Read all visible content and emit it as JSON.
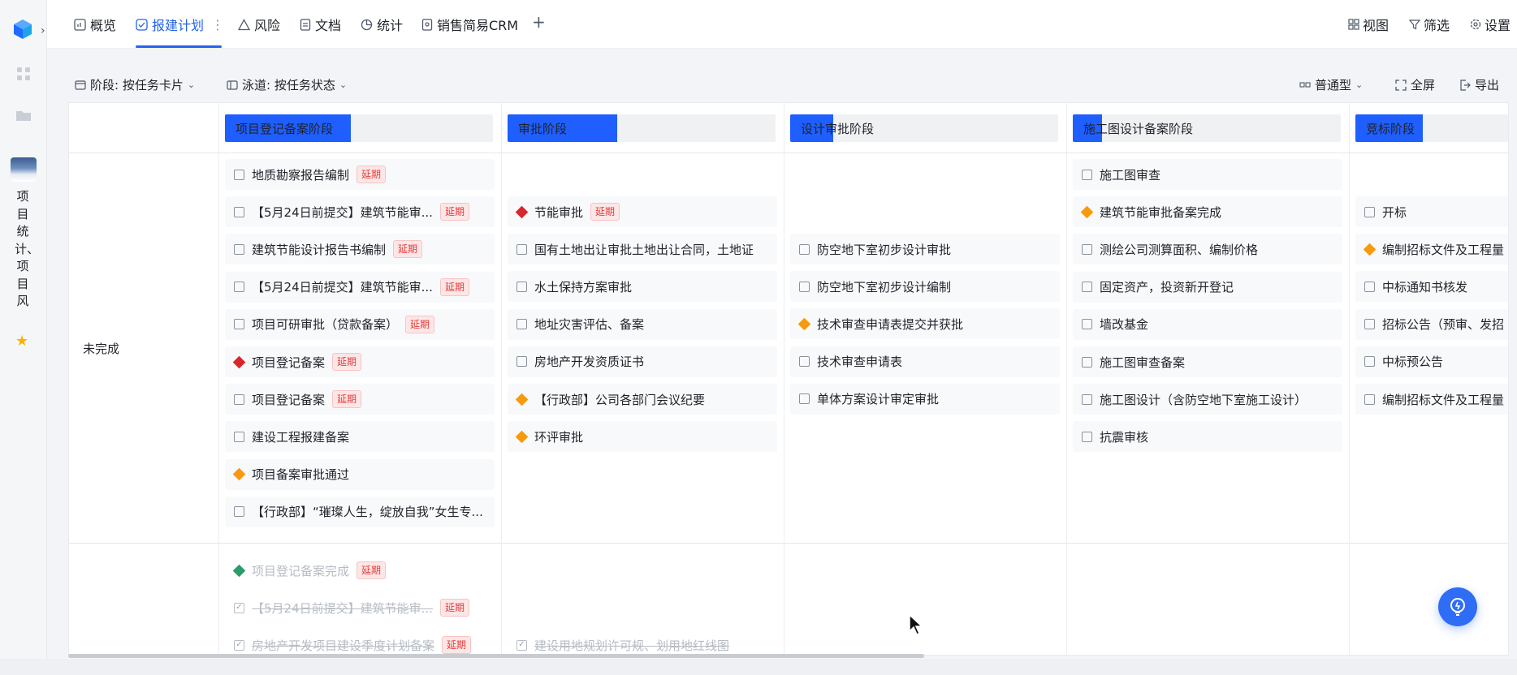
{
  "rail": {
    "logo_icon": "cube-logo-icon",
    "expand_icon": "chevron-right-icon",
    "apps_icon": "apps-grid-icon",
    "folder_icon": "folder-icon",
    "project_name": "项目统计、项目风",
    "favorite_icon": "star-icon"
  },
  "tabs": [
    {
      "label": "概览",
      "icon": "overview-icon"
    },
    {
      "label": "报建计划",
      "icon": "check-circle-icon",
      "active": true
    },
    {
      "label": "风险",
      "icon": "warning-icon"
    },
    {
      "label": "文档",
      "icon": "document-icon"
    },
    {
      "label": "统计",
      "icon": "chart-icon"
    },
    {
      "label": "销售简易CRM",
      "icon": "crm-icon"
    }
  ],
  "more_icon": "vertical-dots-icon",
  "add_tab_icon": "plus-icon",
  "top_actions": {
    "view": "视图",
    "filter": "筛选",
    "settings": "设置"
  },
  "toolbar": {
    "stage": "阶段: 按任务卡片",
    "lane": "泳道: 按任务状态",
    "card_type": "普通型",
    "fullscreen": "全屏",
    "export": "导出"
  },
  "colors": {
    "accent": "#1f5eff",
    "red": "#d8262b",
    "orange": "#f79a0d",
    "green": "#2e9b6b"
  },
  "stages": [
    {
      "title": "项目登记备案阶段",
      "progress": 0.47
    },
    {
      "title": "审批阶段",
      "progress": 0.41
    },
    {
      "title": "设计审批阶段",
      "progress": 0.16
    },
    {
      "title": "施工图设计备案阶段",
      "progress": 0.11
    },
    {
      "title": "竞标阶段",
      "progress": 0.25
    }
  ],
  "lanes": {
    "incomplete": "未完成"
  },
  "delay_label": "延期",
  "columns": [
    {
      "incomplete": [
        {
          "text": "地质勘察报告编制",
          "marker": "checkbox",
          "delay": true
        },
        {
          "text": "【5月24日前提交】建筑节能审...",
          "marker": "checkbox",
          "delay": true
        },
        {
          "text": "建筑节能设计报告书编制",
          "marker": "checkbox",
          "delay": true
        },
        {
          "text": "【5月24日前提交】建筑节能审...",
          "marker": "checkbox",
          "delay": true
        },
        {
          "text": "项目可研审批（贷款备案）",
          "marker": "checkbox",
          "delay": true
        },
        {
          "text": "项目登记备案",
          "marker": "red",
          "delay": true
        },
        {
          "text": "项目登记备案",
          "marker": "checkbox",
          "delay": true
        },
        {
          "text": "建设工程报建备案",
          "marker": "checkbox",
          "delay": false
        },
        {
          "text": "项目备案审批通过",
          "marker": "orange",
          "delay": false
        },
        {
          "text": "【行政部】“璀璨人生，绽放自我”女生专...",
          "marker": "checkbox",
          "delay": false
        }
      ],
      "complete": [
        {
          "text": "项目登记备案完成",
          "marker": "green",
          "delay": true
        },
        {
          "text": "【5月24日前提交】建筑节能审...",
          "marker": "checked",
          "delay": true
        },
        {
          "text": "房地产开发项目建设季度计划备案",
          "marker": "checked",
          "delay": true
        }
      ]
    },
    {
      "incomplete": [
        {
          "text": "节能审批",
          "marker": "red",
          "delay": true
        },
        {
          "text": "国有土地出让审批土地出让合同，土地证",
          "marker": "checkbox",
          "delay": false
        },
        {
          "text": "水土保持方案审批",
          "marker": "checkbox",
          "delay": false
        },
        {
          "text": "地址灾害评估、备案",
          "marker": "checkbox",
          "delay": false
        },
        {
          "text": "房地产开发资质证书",
          "marker": "checkbox",
          "delay": false
        },
        {
          "text": "【行政部】公司各部门会议纪要",
          "marker": "orange",
          "delay": false
        },
        {
          "text": "环评审批",
          "marker": "orange",
          "delay": false
        }
      ],
      "complete": [
        {
          "text": "建设用地规划许可规、划用地红线图",
          "marker": "checked",
          "delay": false
        }
      ]
    },
    {
      "incomplete": [
        {
          "text": "防空地下室初步设计审批",
          "marker": "checkbox",
          "delay": false
        },
        {
          "text": "防空地下室初步设计编制",
          "marker": "checkbox",
          "delay": false
        },
        {
          "text": "技术审查申请表提交并获批",
          "marker": "orange",
          "delay": false
        },
        {
          "text": "技术审查申请表",
          "marker": "checkbox",
          "delay": false
        },
        {
          "text": "单体方案设计审定审批",
          "marker": "checkbox",
          "delay": false
        }
      ],
      "complete": []
    },
    {
      "incomplete": [
        {
          "text": "施工图审查",
          "marker": "checkbox",
          "delay": false
        },
        {
          "text": "建筑节能审批备案完成",
          "marker": "orange",
          "delay": false
        },
        {
          "text": "测绘公司测算面积、编制价格",
          "marker": "checkbox",
          "delay": false
        },
        {
          "text": "固定资产，投资新开登记",
          "marker": "checkbox",
          "delay": false
        },
        {
          "text": "墙改基金",
          "marker": "checkbox",
          "delay": false
        },
        {
          "text": "施工图审查备案",
          "marker": "checkbox",
          "delay": false
        },
        {
          "text": "施工图设计（含防空地下室施工设计）",
          "marker": "checkbox",
          "delay": false
        },
        {
          "text": "抗震审核",
          "marker": "checkbox",
          "delay": false
        }
      ],
      "complete": []
    },
    {
      "incomplete": [
        {
          "text": "开标",
          "marker": "checkbox",
          "delay": false
        },
        {
          "text": "编制招标文件及工程量",
          "marker": "orange",
          "delay": false
        },
        {
          "text": "中标通知书核发",
          "marker": "checkbox",
          "delay": false
        },
        {
          "text": "招标公告（预审、发招",
          "marker": "checkbox",
          "delay": false
        },
        {
          "text": "中标预公告",
          "marker": "checkbox",
          "delay": false
        },
        {
          "text": "编制招标文件及工程量",
          "marker": "checkbox",
          "delay": false
        }
      ],
      "complete": []
    }
  ],
  "help_icon": "lightbulb-icon",
  "cursor_icon": "mouse-pointer-icon"
}
